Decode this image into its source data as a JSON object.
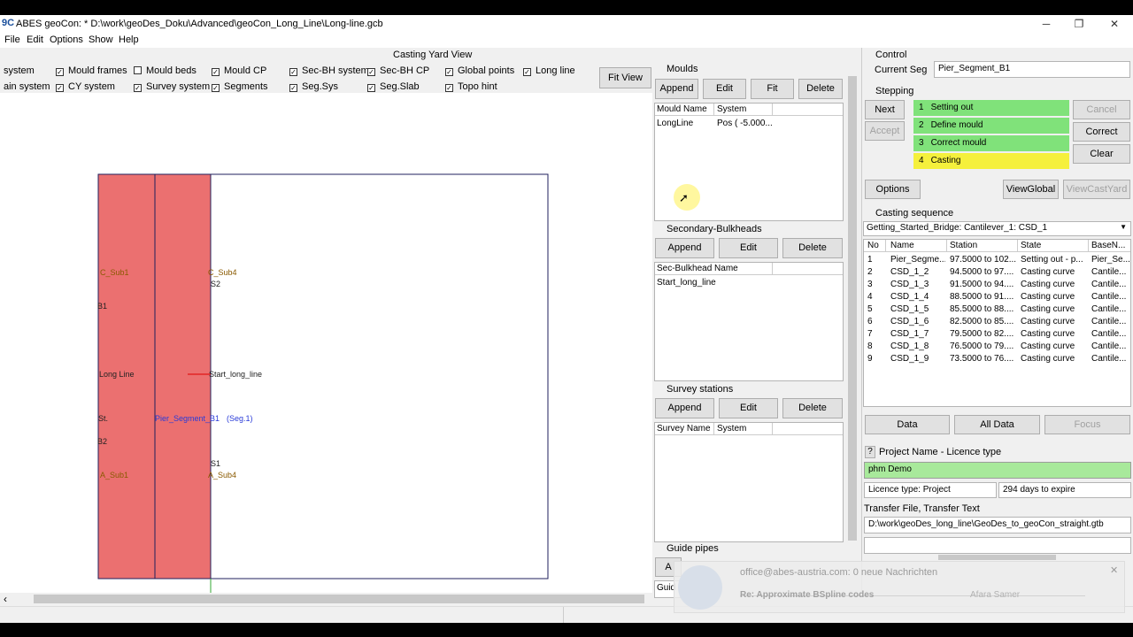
{
  "window": {
    "app_icon": "9C",
    "title": "ABES geoCon:  * D:\\work\\geoDes_Doku\\Advanced\\geoCon_Long_Line\\Long-line.gcb",
    "minimize": "─",
    "restore": "❐",
    "close": "✕"
  },
  "menu": [
    "File",
    "Edit",
    "Options",
    "Show",
    "Help"
  ],
  "casting_yard": {
    "title": "Casting Yard View",
    "fit_view": "Fit View",
    "checkboxes": [
      {
        "label": "system",
        "checked": true
      },
      {
        "label": "Mould frames",
        "checked": true
      },
      {
        "label": "Mould beds",
        "checked": false
      },
      {
        "label": "Mould CP",
        "checked": true
      },
      {
        "label": "Sec-BH system",
        "checked": true
      },
      {
        "label": "Sec-BH CP",
        "checked": true
      },
      {
        "label": "Global points",
        "checked": true
      },
      {
        "label": "Long line",
        "checked": true
      },
      {
        "label": "ain system",
        "checked": true
      },
      {
        "label": "CY system",
        "checked": true
      },
      {
        "label": "Survey system",
        "checked": true
      },
      {
        "label": "Segments",
        "checked": true
      },
      {
        "label": "Seg.Sys",
        "checked": true
      },
      {
        "label": "Seg.Slab",
        "checked": true
      },
      {
        "label": "Topo hint",
        "checked": true
      }
    ],
    "drawing_labels": {
      "c_sub1": "C_Sub1",
      "c_sub4": "C_Sub4",
      "s2": "S2",
      "b1": "B1",
      "long_line_left": "Long Line",
      "start_long_line": "Start_long_line",
      "st": "St.",
      "pier_segment": "Pier_Segment_B1",
      "seg1": "(Seg.1)",
      "b2": "B2",
      "s1": "S1",
      "a_sub1": "A_Sub1",
      "a_sub4": "A_Sub4"
    },
    "scroll_left": "‹"
  },
  "moulds": {
    "title": "Moulds",
    "buttons": [
      "Append",
      "Edit",
      "Fit",
      "Delete"
    ],
    "headers": [
      "Mould Name",
      "System"
    ],
    "rows": [
      {
        "name": "LongLine",
        "system": "Pos ( -5.000..."
      }
    ]
  },
  "sec_bulkheads": {
    "title": "Secondary-Bulkheads",
    "buttons": [
      "Append",
      "Edit",
      "Delete"
    ],
    "headers": [
      "Sec-Bulkhead Name"
    ],
    "rows": [
      "Start_long_line"
    ]
  },
  "survey": {
    "title": "Survey stations",
    "buttons": [
      "Append",
      "Edit",
      "Delete"
    ],
    "headers": [
      "Survey Name",
      "System"
    ]
  },
  "guide_pipes": {
    "title": "Guide pipes",
    "partial_button": "A",
    "partial_header": "Guid"
  },
  "control": {
    "title": "Control",
    "current_seg_label": "Current Seg",
    "current_seg_value": "Pier_Segment_B1"
  },
  "stepping": {
    "title": "Stepping",
    "next": "Next",
    "accept": "Accept",
    "cancel": "Cancel",
    "correct": "Correct",
    "clear": "Clear",
    "steps": [
      {
        "num": "1",
        "label": "Setting out",
        "color": "#80e27a"
      },
      {
        "num": "2",
        "label": "Define mould",
        "color": "#80e27a"
      },
      {
        "num": "3",
        "label": "Correct mould",
        "color": "#80e27a"
      },
      {
        "num": "4",
        "label": "Casting",
        "color": "#f5f03c"
      }
    ],
    "options": "Options",
    "view_global": "ViewGlobal",
    "view_cast_yard": "ViewCastYard"
  },
  "casting_sequence": {
    "title": "Casting sequence",
    "selected": "Getting_Started_Bridge: Cantilever_1: CSD_1",
    "headers": [
      "No",
      "Name",
      "Station",
      "State",
      "BaseN..."
    ],
    "rows": [
      [
        "1",
        "Pier_Segme...",
        "97.5000 to 102...",
        "Setting out - p...",
        "Pier_Se..."
      ],
      [
        "2",
        "CSD_1_2",
        "94.5000 to 97....",
        "Casting curve",
        "Cantile..."
      ],
      [
        "3",
        "CSD_1_3",
        "91.5000 to 94....",
        "Casting curve",
        "Cantile..."
      ],
      [
        "4",
        "CSD_1_4",
        "88.5000 to 91....",
        "Casting curve",
        "Cantile..."
      ],
      [
        "5",
        "CSD_1_5",
        "85.5000 to 88....",
        "Casting curve",
        "Cantile..."
      ],
      [
        "6",
        "CSD_1_6",
        "82.5000 to 85....",
        "Casting curve",
        "Cantile..."
      ],
      [
        "7",
        "CSD_1_7",
        "79.5000 to 82....",
        "Casting curve",
        "Cantile..."
      ],
      [
        "8",
        "CSD_1_8",
        "76.5000 to 79....",
        "Casting curve",
        "Cantile..."
      ],
      [
        "9",
        "CSD_1_9",
        "73.5000 to 76....",
        "Casting curve",
        "Cantile..."
      ]
    ],
    "data": "Data",
    "all_data": "All Data",
    "focus": "Focus"
  },
  "project": {
    "help": "?",
    "label": "Project Name - Licence type",
    "name": "phm Demo",
    "licence_type": "Licence type: Project",
    "expire": "294 days to expire",
    "transfer_label": "Transfer File, Transfer Text",
    "transfer_file": "D:\\work\\geoDes_long_line\\GeoDes_to_geoCon_straight.gtb"
  },
  "notification": {
    "sender": "office@abes-austria.com: 0 neue Nachrichten",
    "subject": "Re: Approximate BSpline codes",
    "from": "Afara Samer",
    "close": "✕"
  }
}
